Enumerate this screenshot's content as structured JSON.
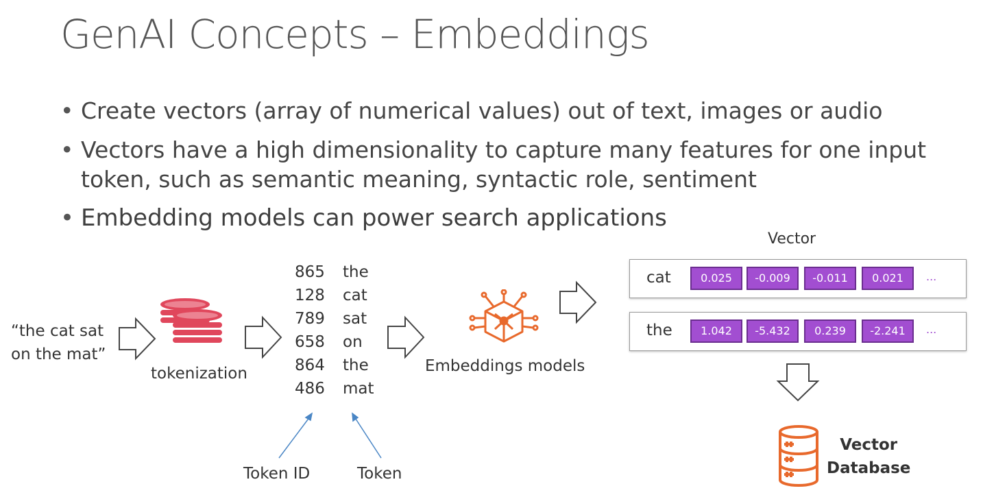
{
  "slide": {
    "title": "GenAI Concepts – Embeddings",
    "bullets": [
      "Create vectors (array of numerical values) out of text, images or audio",
      "Vectors have a high dimensionality to capture many features for one input token, such as semantic meaning, syntactic role, sentiment",
      "Embedding models can power search applications"
    ]
  },
  "diagram": {
    "input_line1": "“the cat sat",
    "input_line2": "on the mat”",
    "tokenization_label": "tokenization",
    "tokens": [
      {
        "id": "865",
        "token": "the"
      },
      {
        "id": "128",
        "token": "cat"
      },
      {
        "id": "789",
        "token": "sat"
      },
      {
        "id": "658",
        "token": "on"
      },
      {
        "id": "864",
        "token": "the"
      },
      {
        "id": "486",
        "token": "mat"
      }
    ],
    "token_id_label": "Token ID",
    "token_label": "Token",
    "embeddings_label": "Embeddings models",
    "vector_heading": "Vector",
    "vectors": [
      {
        "word": "cat",
        "values": [
          "0.025",
          "-0.009",
          "-0.011",
          "0.021"
        ],
        "ellipsis": "..."
      },
      {
        "word": "the",
        "values": [
          "1.042",
          "-5.432",
          "0.239",
          "-2.241"
        ],
        "ellipsis": "..."
      }
    ],
    "vector_db_line1": "Vector",
    "vector_db_line2": "Database"
  },
  "colors": {
    "token_icon": "#e0475c",
    "model_icon": "#e8692c",
    "vector_cell": "#a24ed1",
    "database_icon": "#e8692c",
    "pointer_arrow": "#4a86c5"
  },
  "icons": [
    "stacked-coins-icon",
    "neural-network-cube-icon",
    "database-icon",
    "hollow-arrow-icon"
  ]
}
